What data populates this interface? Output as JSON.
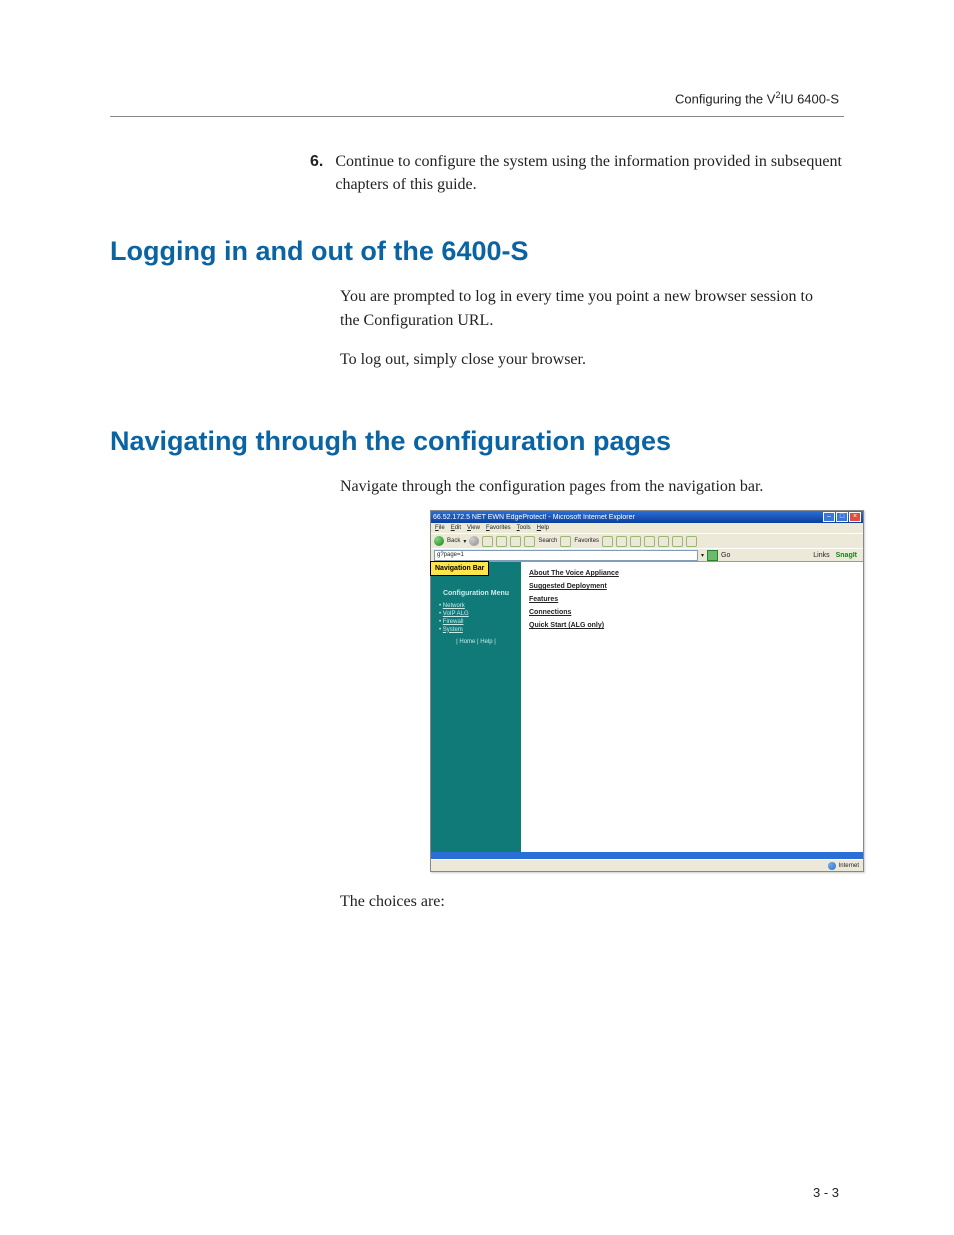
{
  "header": "Configuring the V²IU 6400-S",
  "step": {
    "num": "6.",
    "text": "Continue to configure the system using the information provided in subsequent chapters of this guide."
  },
  "sections": {
    "login": {
      "title": "Logging in and out of the 6400-S",
      "p1": "You are prompted to log in every time you point a new browser session to the Configuration URL.",
      "p2": "To log out, simply close your browser."
    },
    "nav": {
      "title": "Navigating through the configuration pages",
      "p1": "Navigate through the configuration pages from the navigation bar.",
      "p2": "The choices are:"
    }
  },
  "screenshot": {
    "window_title": "66.52.172.5 NET EWN EdgeProtect! - Microsoft Internet Explorer",
    "menubar": [
      "File",
      "Edit",
      "View",
      "Favorites",
      "Tools",
      "Help"
    ],
    "toolbar": {
      "back": "Back",
      "search": "Search",
      "favorites": "Favorites"
    },
    "address_field": "g?page=1",
    "go": "Go",
    "links_label": "Links",
    "snagit": "SnagIt",
    "nav_bar_callout": "Navigation Bar",
    "sidebar": {
      "title": "Configuration Menu",
      "items": [
        "Network",
        "VoIP ALG",
        "Firewall",
        "System"
      ],
      "footer": "| Home | Help |"
    },
    "main_links": [
      "About The Voice Appliance",
      "Suggested Deployment",
      "Features",
      "Connections",
      "Quick Start (ALG only)"
    ],
    "status": "Internet"
  },
  "page_number": "3 - 3"
}
